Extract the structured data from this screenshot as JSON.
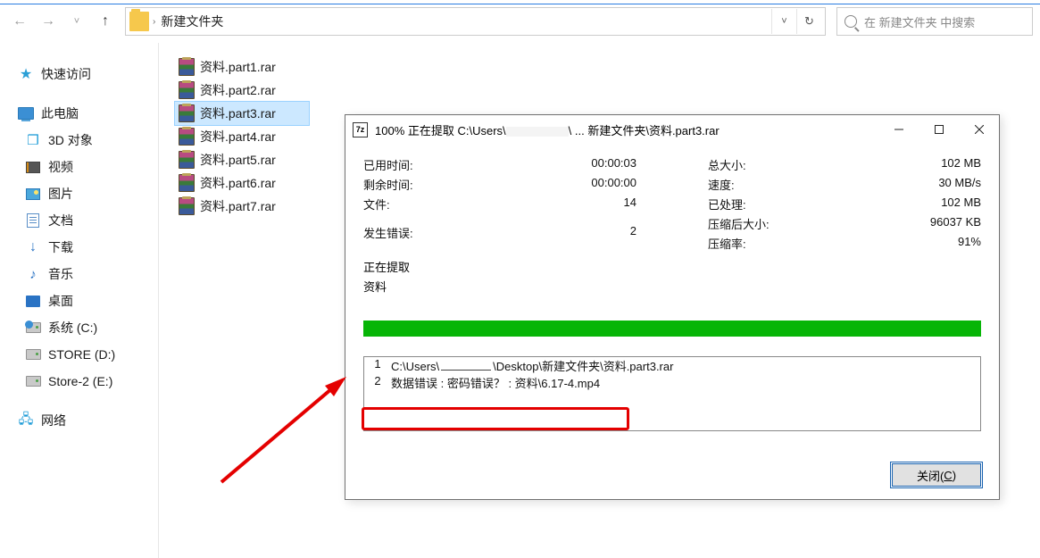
{
  "addressbar": {
    "folder": "新建文件夹",
    "search_placeholder": "在 新建文件夹 中搜索"
  },
  "sidebar": {
    "quick": "快速访问",
    "pc": "此电脑",
    "items": {
      "threed": "3D 对象",
      "video": "视频",
      "pictures": "图片",
      "documents": "文档",
      "downloads": "下载",
      "music": "音乐",
      "desktop": "桌面",
      "drive_c": "系统 (C:)",
      "drive_d": "STORE (D:)",
      "drive_e": "Store-2 (E:)"
    },
    "network": "网络"
  },
  "files": [
    {
      "name": "资料.part1.rar"
    },
    {
      "name": "资料.part2.rar"
    },
    {
      "name": "资料.part3.rar",
      "selected": true
    },
    {
      "name": "资料.part4.rar"
    },
    {
      "name": "资料.part5.rar"
    },
    {
      "name": "资料.part6.rar"
    },
    {
      "name": "资料.part7.rar"
    }
  ],
  "dialog": {
    "title_pre": "100% 正在提取 C:\\Users\\",
    "title_post": "\\ ... 新建文件夹\\资料.part3.rar",
    "stats_left": {
      "elapsed_label": "已用时间:",
      "elapsed": "00:00:03",
      "remain_label": "剩余时间:",
      "remain": "00:00:00",
      "files_label": "文件:",
      "files": "14",
      "errors_label": "发生错误:",
      "errors": "2",
      "extracting_label": "正在提取",
      "extracting_target": "资料"
    },
    "stats_right": {
      "total_label": "总大小:",
      "total": "102 MB",
      "speed_label": "速度:",
      "speed": "30 MB/s",
      "processed_label": "已处理:",
      "processed": "102 MB",
      "compressed_label": "压缩后大小:",
      "compressed": "96037 KB",
      "ratio_label": "压缩率:",
      "ratio": "91%"
    },
    "log": [
      {
        "n": "1",
        "pre": "C:\\Users\\",
        "post": "\\Desktop\\新建文件夹\\资料.part3.rar"
      },
      {
        "n": "2",
        "text": "数据错误 : 密码错误？ : 资料\\6.17-4.mp4"
      }
    ],
    "close_pre": "关闭(",
    "close_u": "C",
    "close_post": ")"
  }
}
